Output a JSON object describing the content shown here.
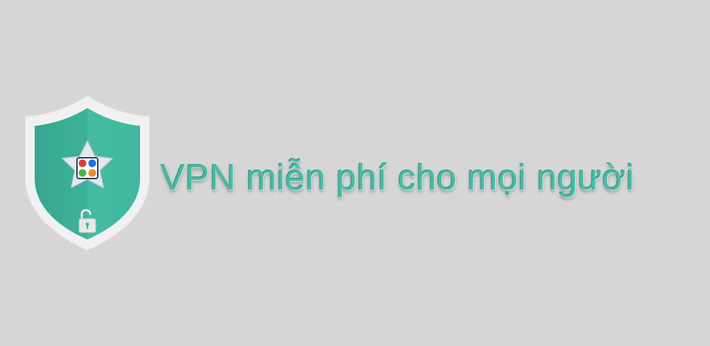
{
  "banner": {
    "tagline": "VPN miễn phí cho mọi người",
    "logo_icon": "shield-star-apps-icon",
    "lock_icon": "unlocked-padlock-icon"
  },
  "colors": {
    "background": "#d6d6d6",
    "shield_outer": "#f1f1f1",
    "shield_inner": "#3db29a",
    "tagline": "#48bba5",
    "star": "#e4e8ea",
    "dot_red": "#e53935",
    "dot_blue": "#1e6fe0",
    "dot_green": "#43b649",
    "dot_orange": "#f08a2a"
  }
}
